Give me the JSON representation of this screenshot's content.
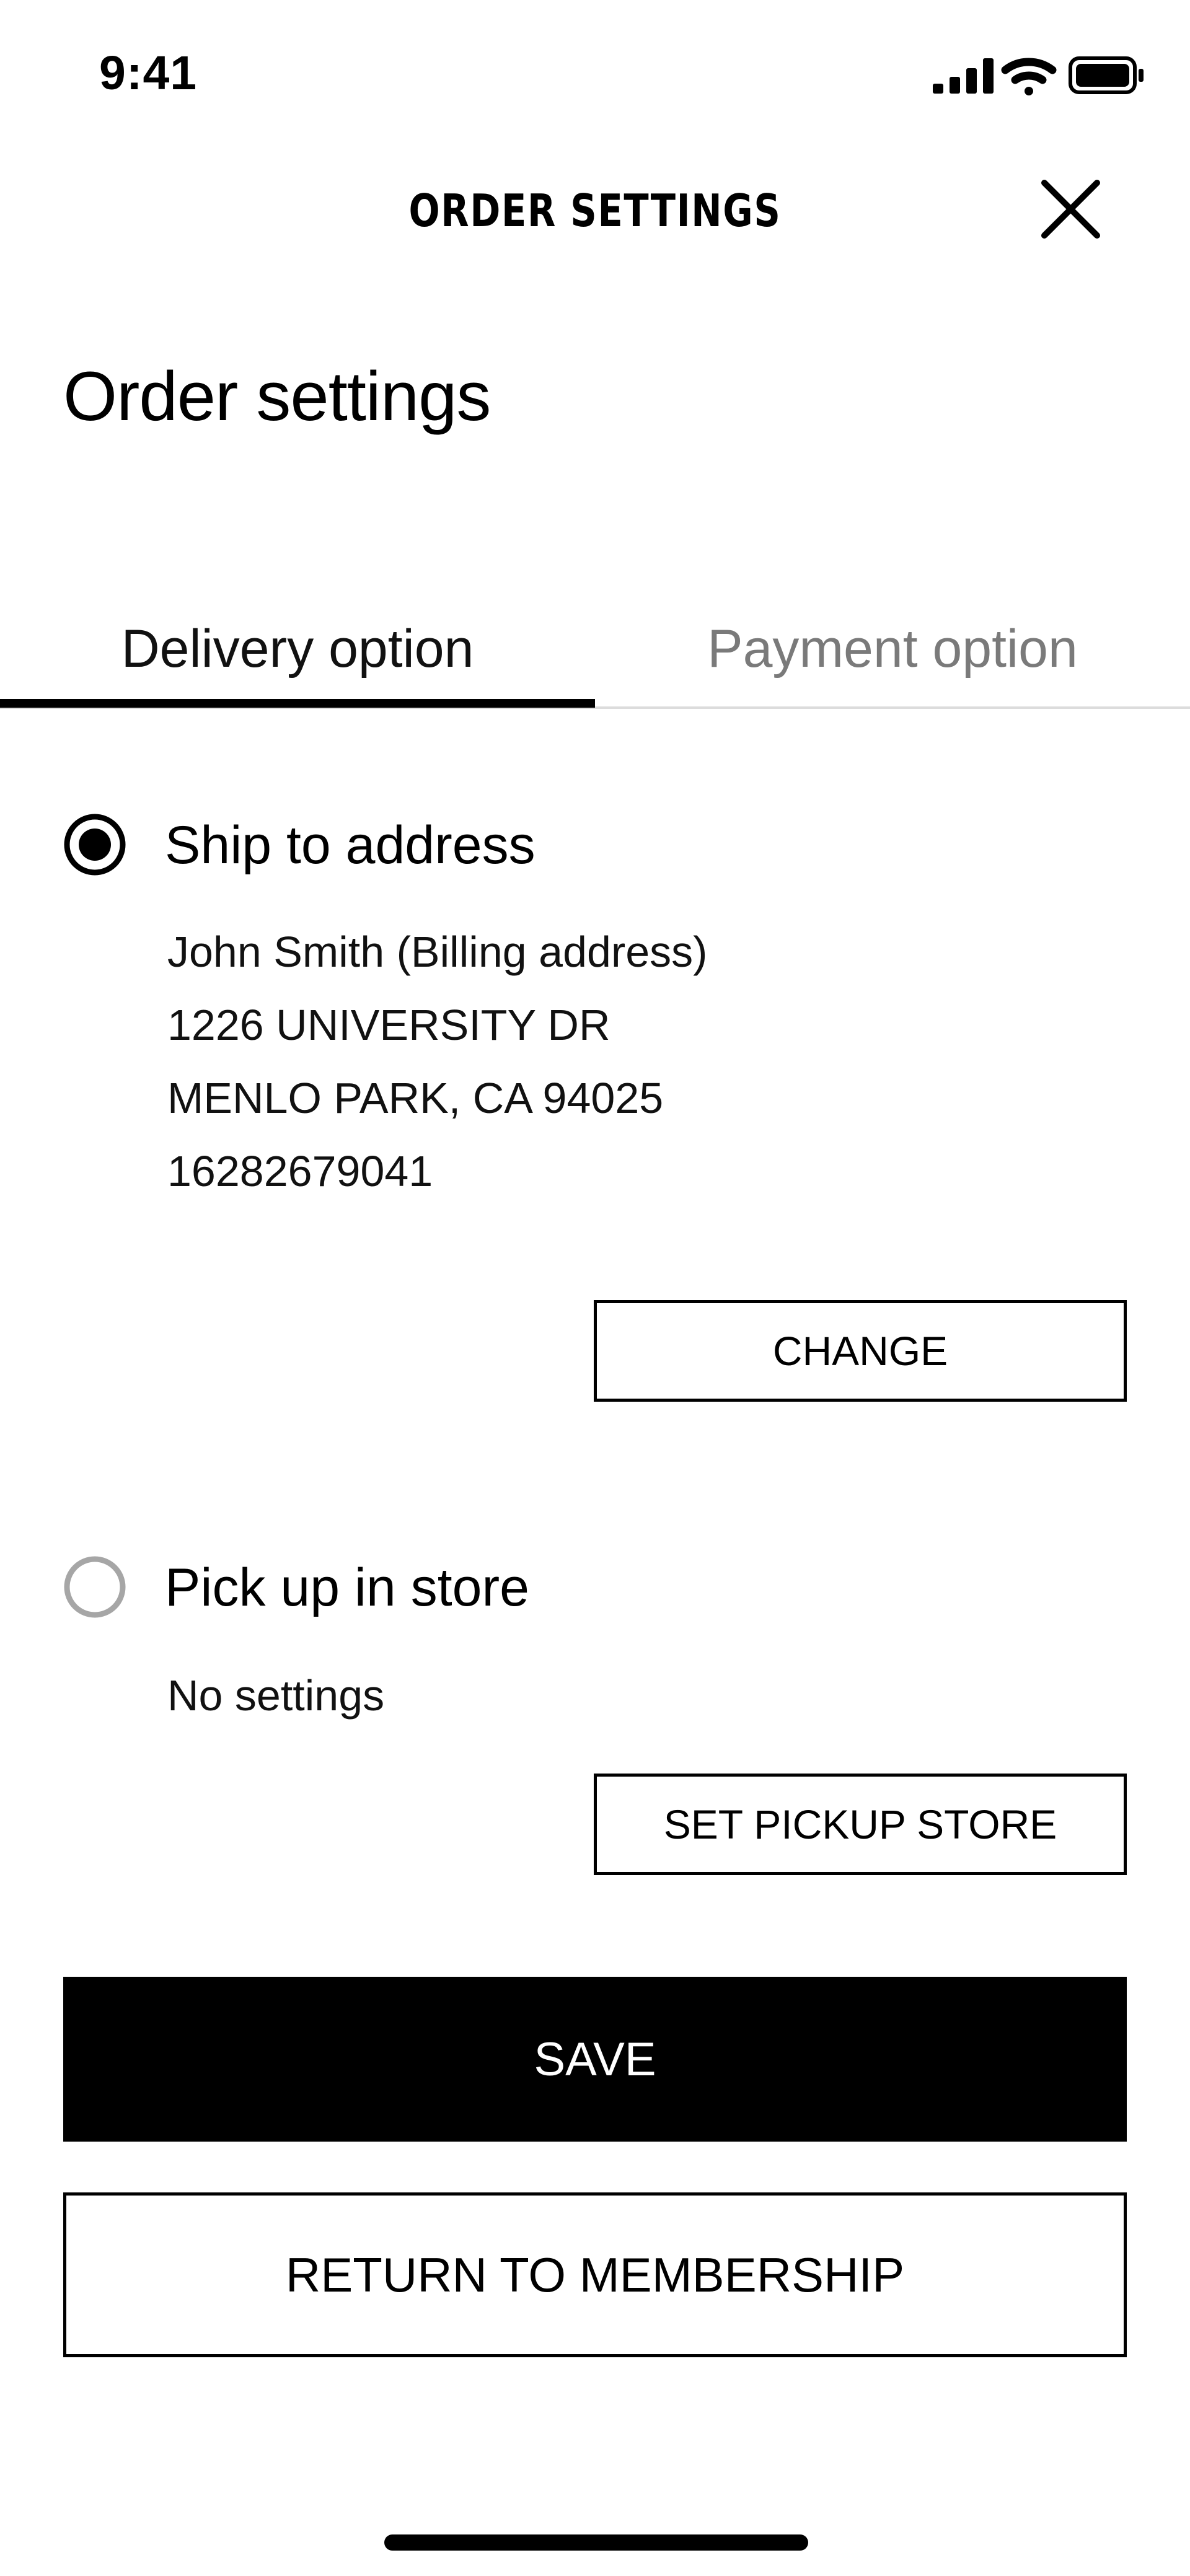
{
  "status_bar": {
    "time": "9:41",
    "icons": [
      "cellular-signal-icon",
      "wifi-icon",
      "battery-icon"
    ]
  },
  "header": {
    "title": "ORDER SETTINGS",
    "close_icon": "close-icon"
  },
  "page": {
    "title": "Order settings"
  },
  "tabs": [
    {
      "label": "Delivery option",
      "selected": true
    },
    {
      "label": "Payment option",
      "selected": false
    }
  ],
  "delivery": {
    "ship_to_address": {
      "label": "Ship to address",
      "selected": true,
      "address_lines": [
        "John Smith (Billing address)",
        "1226 UNIVERSITY DR",
        "MENLO PARK, CA 94025",
        "16282679041"
      ],
      "change_label": "CHANGE"
    },
    "pickup": {
      "label": "Pick up in store",
      "selected": false,
      "status": "No settings",
      "set_store_label": "SET PICKUP STORE"
    }
  },
  "actions": {
    "save_label": "SAVE",
    "return_label": "RETURN TO MEMBERSHIP"
  },
  "colors": {
    "accent": "#000000",
    "inactive_tab": "#7a7a7a",
    "divider": "#dcdcdc",
    "radio_unselected": "#a6a6a6"
  }
}
